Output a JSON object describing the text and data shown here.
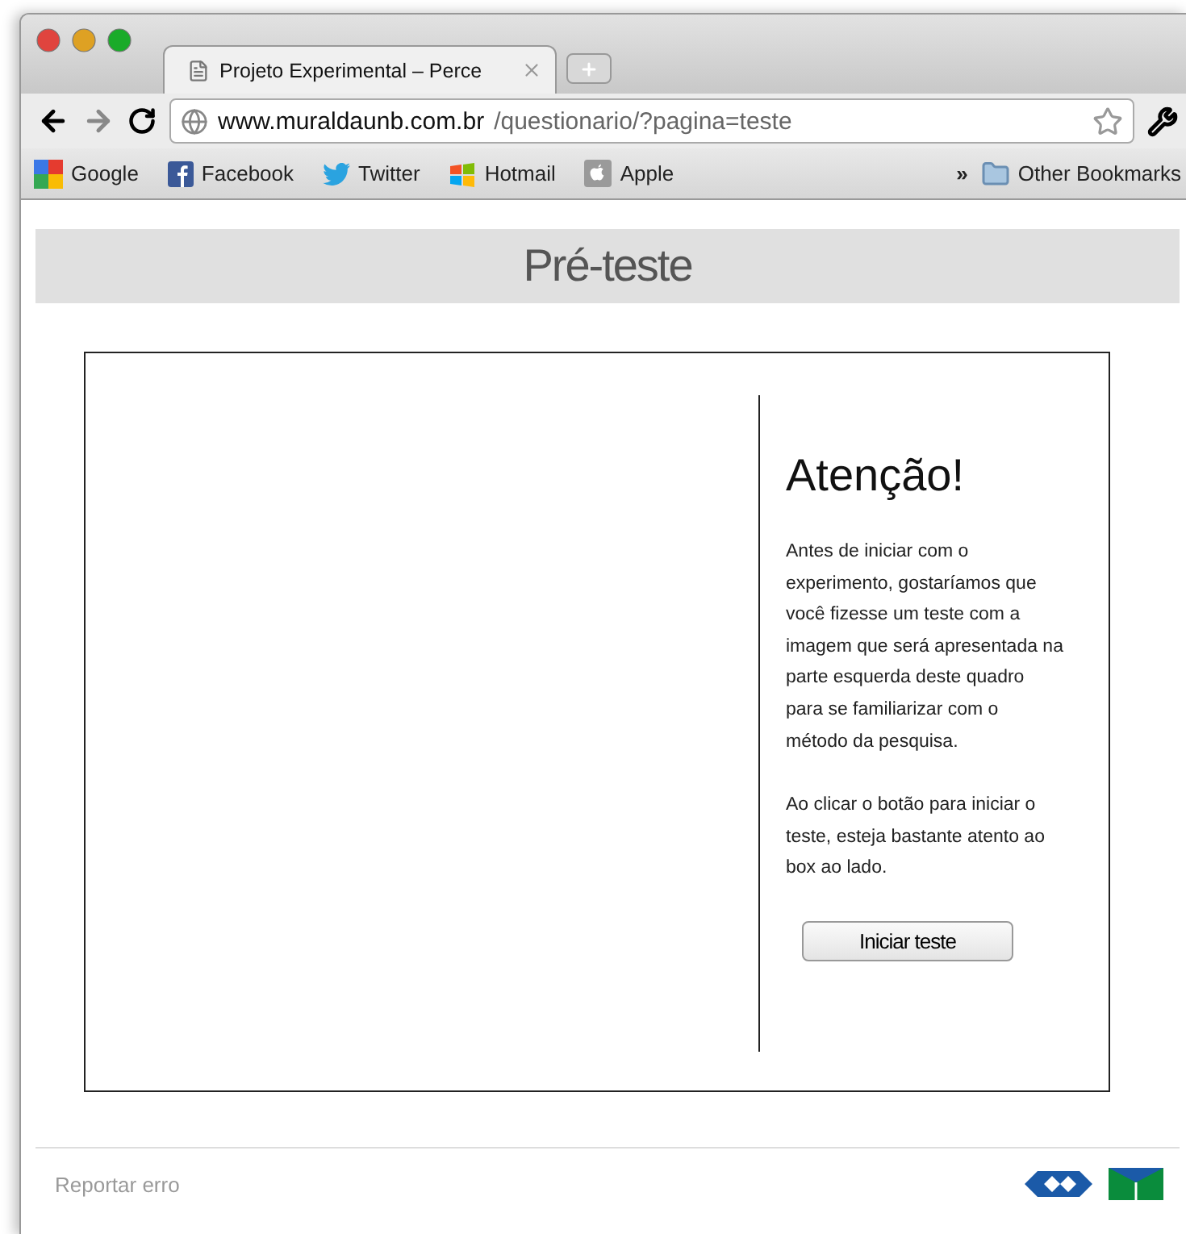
{
  "browser": {
    "tabs": [
      {
        "title": "Projeto Experimental – Perce",
        "selected": true
      }
    ],
    "address": {
      "host": "www.muraldaunb.com.br",
      "path": "/questionario/?pagina=teste"
    },
    "bookmarks": [
      {
        "label": "Google",
        "kind": "google"
      },
      {
        "label": "Facebook",
        "kind": "facebook"
      },
      {
        "label": "Twitter",
        "kind": "twitter"
      },
      {
        "label": "Hotmail",
        "kind": "hotmail"
      },
      {
        "label": "Apple",
        "kind": "apple"
      }
    ],
    "overflow": "»",
    "other_bookmarks": "Other Bookmarks"
  },
  "page": {
    "title": "Pré-teste",
    "panel": {
      "heading": "Atenção!",
      "paragraphs": [
        "Antes de iniciar com o experimento, gostaríamos que você fizesse um teste com a imagem que será apresentada na parte esquerda deste quadro para se familiarizar com o método da pesquisa.",
        "Ao clicar o botão para iniciar o teste, esteja bastante atento ao box ao lado."
      ],
      "button": "Iniciar teste"
    },
    "footer": {
      "link": "Reportar erro"
    }
  }
}
